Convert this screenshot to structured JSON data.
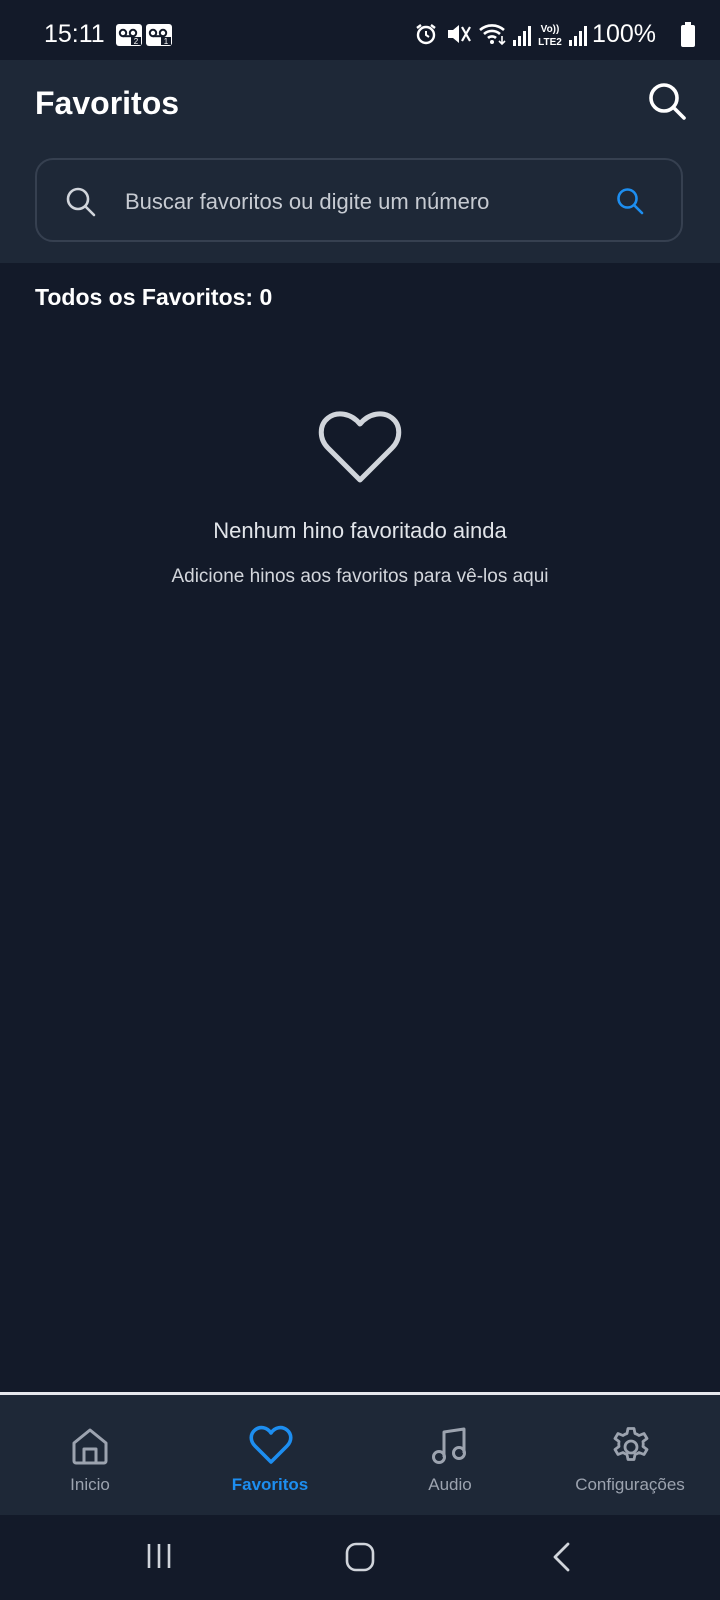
{
  "status_bar": {
    "time": "15:11",
    "battery": "100%",
    "icons": [
      "voicemail-icon",
      "voicemail-icon",
      "alarm-icon",
      "mute-icon",
      "wifi-icon",
      "signal-icon",
      "volte-icon",
      "signal-icon",
      "battery-icon"
    ]
  },
  "header": {
    "title": "Favoritos"
  },
  "search": {
    "placeholder": "Buscar favoritos ou digite um número",
    "value": ""
  },
  "section": {
    "title": "Todos os Favoritos: 0"
  },
  "empty_state": {
    "title": "Nenhum hino favoritado ainda",
    "subtitle": "Adicione hinos aos favoritos para vê-los aqui"
  },
  "tabs": [
    {
      "label": "Inicio",
      "icon": "home-icon",
      "active": false
    },
    {
      "label": "Favoritos",
      "icon": "heart-icon",
      "active": true
    },
    {
      "label": "Audio",
      "icon": "music-note-icon",
      "active": false
    },
    {
      "label": "Configurações",
      "icon": "settings-gear-icon",
      "active": false
    }
  ],
  "colors": {
    "background": "#131a29",
    "surface": "#1e2837",
    "accent": "#1d8ef0",
    "inactive": "#9ca3af"
  }
}
